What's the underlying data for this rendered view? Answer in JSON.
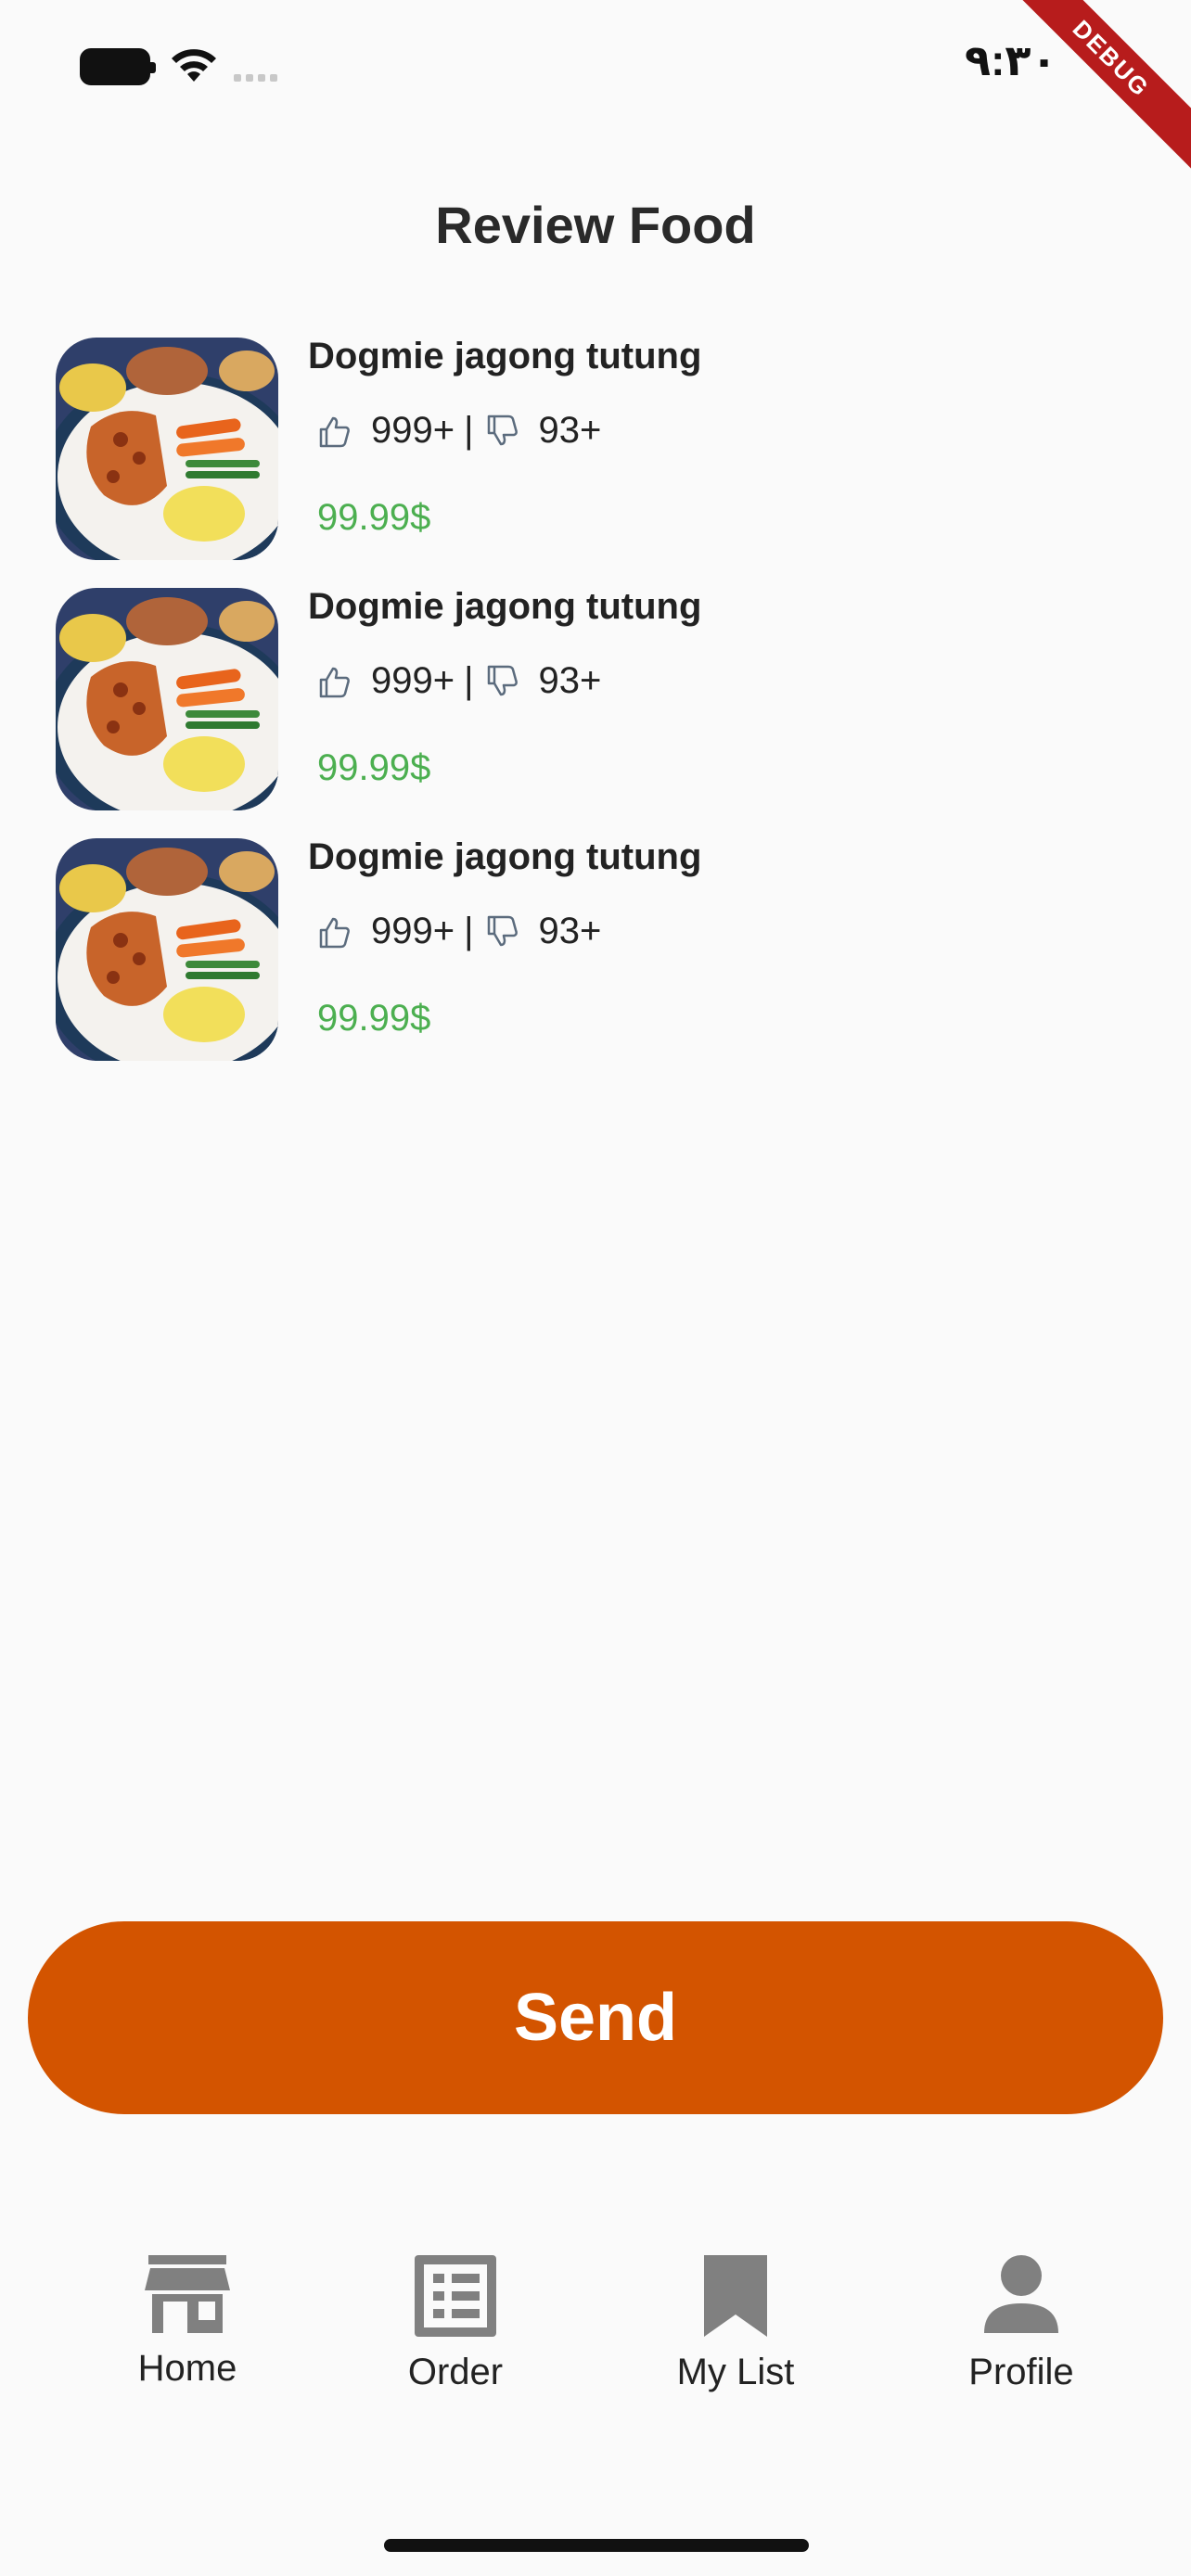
{
  "status_bar": {
    "time": "٩:٣٠",
    "debug_label": "DEBUG"
  },
  "page": {
    "title": "Review Food"
  },
  "items": [
    {
      "name": "Dogmie jagong tutung",
      "likes": "999+",
      "separator": "|",
      "dislikes": "93+",
      "price": "99.99$"
    },
    {
      "name": "Dogmie jagong tutung",
      "likes": "999+",
      "separator": "|",
      "dislikes": "93+",
      "price": "99.99$"
    },
    {
      "name": "Dogmie jagong tutung",
      "likes": "999+",
      "separator": "|",
      "dislikes": "93+",
      "price": "99.99$"
    }
  ],
  "actions": {
    "send_label": "Send"
  },
  "nav": [
    {
      "label": "Home",
      "icon": "store-icon"
    },
    {
      "label": "Order",
      "icon": "list-icon"
    },
    {
      "label": "My List",
      "icon": "bookmark-icon"
    },
    {
      "label": "Profile",
      "icon": "person-icon"
    }
  ],
  "colors": {
    "accent": "#d35400",
    "price": "#4caf50",
    "nav_icon": "#808080"
  }
}
